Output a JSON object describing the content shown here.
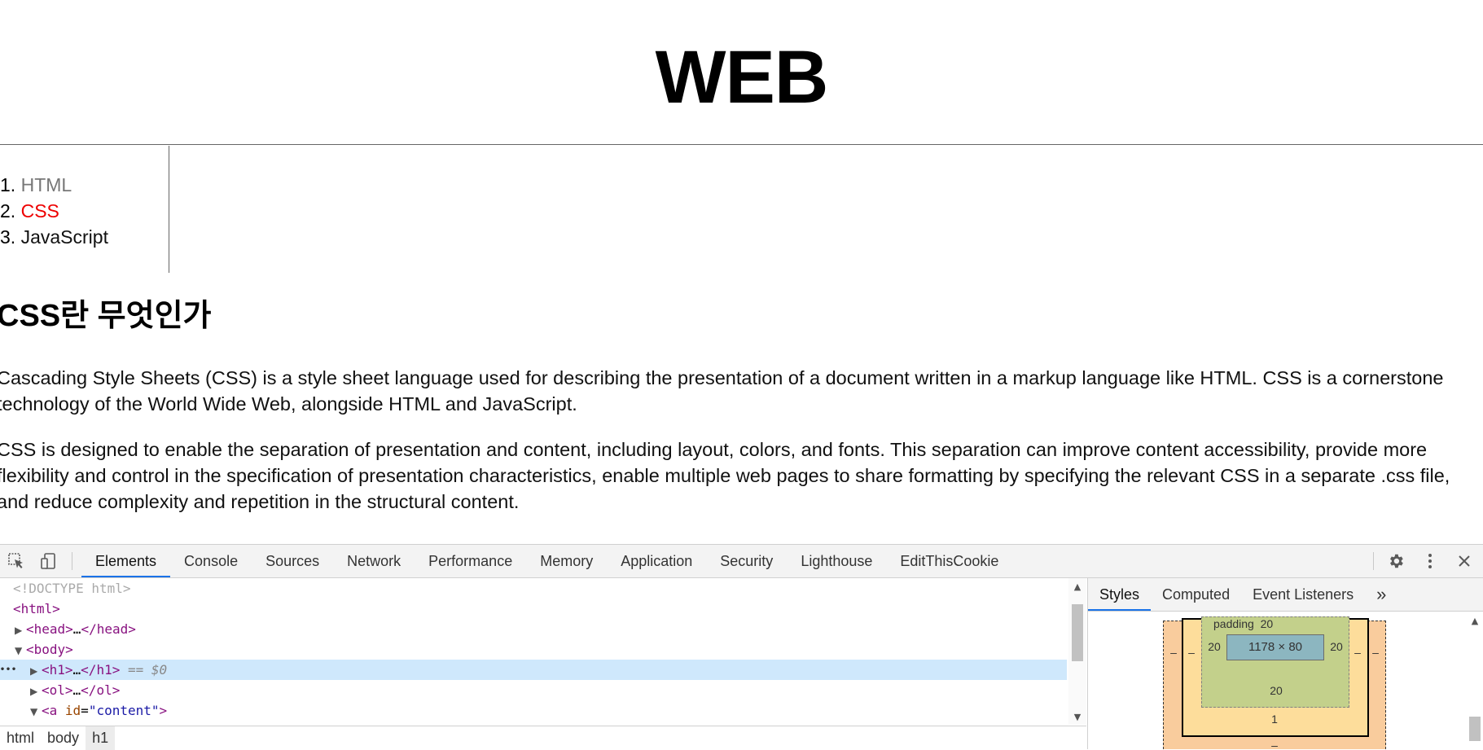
{
  "page": {
    "title": "WEB",
    "nav": [
      {
        "num": "1.",
        "label": "HTML",
        "state": "visited"
      },
      {
        "num": "2.",
        "label": "CSS",
        "state": "active"
      },
      {
        "num": "3.",
        "label": "JavaScript",
        "state": "normal"
      }
    ],
    "article": {
      "heading": "CSS란 무엇인가",
      "p1": "Cascading Style Sheets (CSS) is a style sheet language used for describing the presentation of a document written in a markup language like HTML. CSS is a cornerstone technology of the World Wide Web, alongside HTML and JavaScript.",
      "p2": "CSS is designed to enable the separation of presentation and content, including layout, colors, and fonts. This separation can improve content accessibility, provide more flexibility and control in the specification of presentation characteristics, enable multiple web pages to share formatting by specifying the relevant CSS in a separate .css file, and reduce complexity and repetition in the structural content."
    }
  },
  "devtools": {
    "tabs": [
      "Elements",
      "Console",
      "Sources",
      "Network",
      "Performance",
      "Memory",
      "Application",
      "Security",
      "Lighthouse",
      "EditThisCookie"
    ],
    "active_tab": "Elements",
    "dom": {
      "doctype": "<!DOCTYPE html>",
      "html_open": "<html>",
      "head": "<head>",
      "head_ellipsis": "…",
      "head_close": "</head>",
      "body": "<body>",
      "h1": "<h1>",
      "h1_ellipsis": "…",
      "h1_close": "</h1>",
      "h1_marker": " == $0",
      "ol": "<ol>",
      "ol_ellipsis": "…",
      "ol_close": "</ol>",
      "a_open": "<a ",
      "a_attr": "id",
      "a_eq": "=",
      "a_val": "\"content\"",
      "a_close": ">",
      "dots": "•••"
    },
    "breadcrumb": [
      "html",
      "body",
      "h1"
    ],
    "styles_tabs": [
      "Styles",
      "Computed",
      "Event Listeners"
    ],
    "styles_more": "»",
    "box_model": {
      "padding_label": "padding",
      "padding_top": "20",
      "padding_left": "20",
      "padding_right": "20",
      "padding_bottom": "20",
      "content_size": "1178 × 80",
      "border_bottom": "1",
      "margin_bottom": "–",
      "margin_left": "–",
      "margin_right": "–",
      "border_left": "–",
      "border_right": "–",
      "colors": {
        "margin": "#f9cc9d",
        "border": "#fddd9b",
        "padding": "#c3d08b",
        "content": "#8cb6c0"
      }
    },
    "icons": [
      "inspect-element-icon",
      "device-toggle-icon",
      "settings-gear-icon",
      "more-vertical-icon",
      "close-icon"
    ],
    "accent_color": "#1a73e8"
  }
}
